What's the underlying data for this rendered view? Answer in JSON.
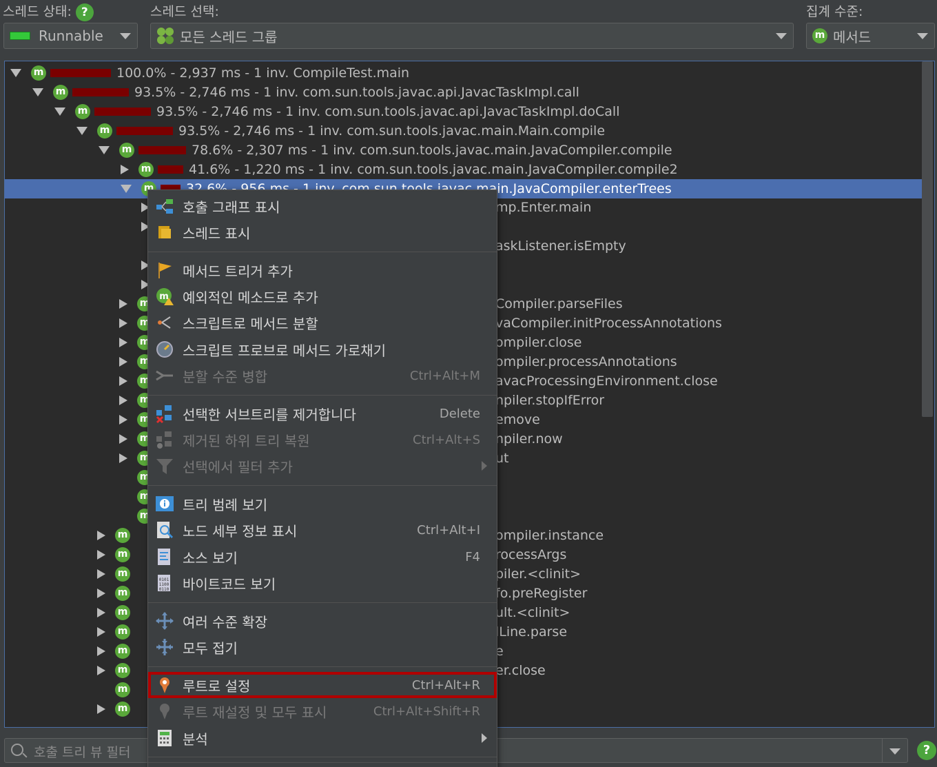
{
  "top": {
    "thread_state_label": "스레드 상태:",
    "thread_select_label": "스레드 선택:",
    "aggregation_label": "집계 수준:",
    "help_glyph": "?",
    "thread_state_value": "Runnable",
    "thread_group_value": "모든 스레드 그룹",
    "aggregation_value": "메서드",
    "m_glyph": "m"
  },
  "tree_rows": [
    {
      "text": "100.0% - 2,937 ms - 1 inv. CompileTest.main",
      "fraction": 1.0,
      "expanded": true
    },
    {
      "text": "93.5% - 2,746 ms - 1 inv. com.sun.tools.javac.api.JavacTaskImpl.call",
      "fraction": 0.935,
      "expanded": true
    },
    {
      "text": "93.5% - 2,746 ms - 1 inv. com.sun.tools.javac.api.JavacTaskImpl.doCall",
      "fraction": 0.935,
      "expanded": true
    },
    {
      "text": "93.5% - 2,746 ms - 1 inv. com.sun.tools.javac.main.Main.compile",
      "fraction": 0.935,
      "expanded": true
    },
    {
      "text": "78.6% - 2,307 ms - 1 inv. com.sun.tools.javac.main.JavaCompiler.compile",
      "fraction": 0.786,
      "expanded": true
    },
    {
      "text": "41.6% - 1,220 ms - 1 inv. com.sun.tools.javac.main.JavaCompiler.compile2",
      "fraction": 0.416,
      "expanded": false
    },
    {
      "text": "32.6% - 956 ms - 1 inv. com.sun.tools.javac.main.JavaCompiler.enterTrees",
      "fraction": 0.326,
      "expanded": true
    }
  ],
  "partial_rows": [
    "mp.Enter.main",
    "askListener.isEmpty",
    "Compiler.parseFiles",
    "vaCompiler.initProcessAnnotations",
    "ompiler.close",
    "ompiler.processAnnotations",
    "avacProcessingEnvironment.close",
    "npiler.stopIfError",
    "emove",
    "npiler.now",
    "ut",
    "ompiler.instance",
    "rocessArgs",
    "piler.<clinit>",
    "fo.preRegister",
    "ult.<clinit>",
    "lLine.parse",
    "e",
    "er.close"
  ],
  "menu": [
    {
      "label": "호출 그래프 표시",
      "shortcut": "",
      "icon": "call-graph-icon",
      "disabled": false
    },
    {
      "label": "스레드 표시",
      "shortcut": "",
      "icon": "thread-icon",
      "disabled": false
    },
    {
      "label": "메서드 트리거 추가",
      "shortcut": "",
      "icon": "flag-icon",
      "disabled": false
    },
    {
      "label": "예외적인 메소드로 추가",
      "shortcut": "",
      "icon": "method-warning-icon",
      "disabled": false
    },
    {
      "label": "스크립트로 메서드 분할",
      "shortcut": "",
      "icon": "split-icon",
      "disabled": false
    },
    {
      "label": "스크립트 프로브로 메서드 가로채기",
      "shortcut": "",
      "icon": "gauge-icon",
      "disabled": false
    },
    {
      "label": "분할 수준 병합",
      "shortcut": "Ctrl+Alt+M",
      "icon": "merge-icon",
      "disabled": true
    },
    {
      "label": "선택한 서브트리를 제거합니다",
      "shortcut": "Delete",
      "icon": "remove-subtree-icon",
      "disabled": false
    },
    {
      "label": "제거된 하위 트리 복원",
      "shortcut": "Ctrl+Alt+S",
      "icon": "restore-subtree-icon",
      "disabled": true
    },
    {
      "label": "선택에서 필터 추가",
      "shortcut": "",
      "icon": "filter-icon",
      "disabled": true,
      "submenu": true
    },
    {
      "label": "트리 범례 보기",
      "shortcut": "",
      "icon": "info-icon",
      "disabled": false
    },
    {
      "label": "노드 세부 정보 표시",
      "shortcut": "Ctrl+Alt+I",
      "icon": "details-icon",
      "disabled": false
    },
    {
      "label": "소스 보기",
      "shortcut": "F4",
      "icon": "source-icon",
      "disabled": false
    },
    {
      "label": "바이트코드 보기",
      "shortcut": "",
      "icon": "bytecode-icon",
      "disabled": false
    },
    {
      "label": "여러 수준 확장",
      "shortcut": "",
      "icon": "expand-icon",
      "disabled": false
    },
    {
      "label": "모두 접기",
      "shortcut": "",
      "icon": "collapse-icon",
      "disabled": false
    },
    {
      "label": "루트로 설정",
      "shortcut": "Ctrl+Alt+R",
      "icon": "pin-icon",
      "disabled": false,
      "highlighted": true
    },
    {
      "label": "루트 재설정 및 모두 표시",
      "shortcut": "Ctrl+Alt+Shift+R",
      "icon": "reset-root-icon",
      "disabled": true
    },
    {
      "label": "분석",
      "shortcut": "",
      "icon": "calculator-icon",
      "disabled": false,
      "submenu": true
    }
  ],
  "filter": {
    "placeholder": "호출 트리 뷰 필터"
  },
  "colors": {
    "accent": "#4b6eaf",
    "bar": "#7a0000",
    "highlight_border": "#b00000",
    "method_green": "#5aa83a"
  }
}
